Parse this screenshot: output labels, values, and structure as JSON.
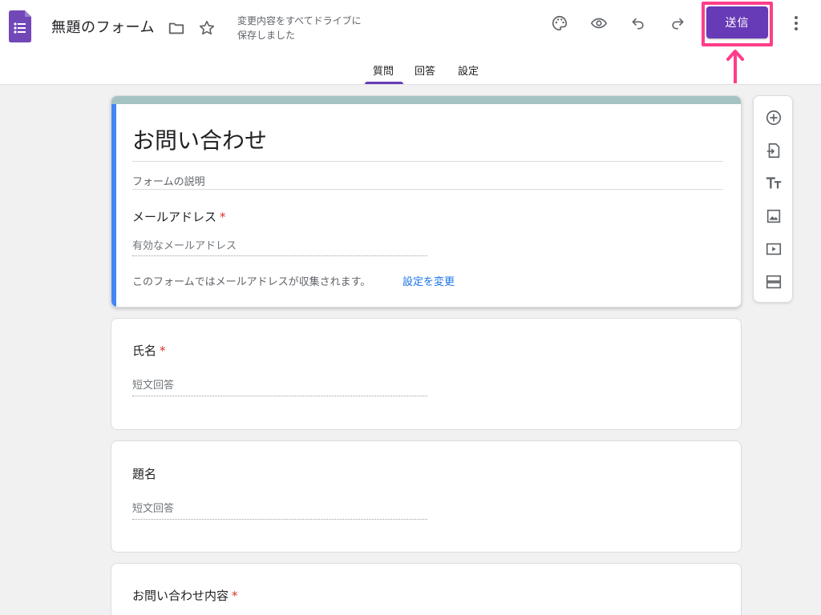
{
  "header": {
    "doc_title": "無題のフォーム",
    "save_status_line1": "変更内容をすべてドライブに",
    "save_status_line2": "保存しました",
    "send_label": "送信",
    "icons": [
      "forms-app-logo",
      "folder-icon",
      "star-icon",
      "palette-icon",
      "preview-eye-icon",
      "undo-icon",
      "redo-icon",
      "more-vert-icon"
    ]
  },
  "tabs": [
    {
      "label": "質問",
      "active": true
    },
    {
      "label": "回答",
      "active": false
    },
    {
      "label": "設定",
      "active": false
    }
  ],
  "form": {
    "title": "お問い合わせ",
    "description_placeholder": "フォームの説明",
    "email_question": {
      "label": "メールアドレス",
      "required_mark": "*",
      "placeholder": "有効なメールアドレス",
      "note": "このフォームではメールアドレスが収集されます。",
      "link": "設定を変更"
    },
    "questions": [
      {
        "label": "氏名",
        "required_mark": "*",
        "placeholder": "短文回答"
      },
      {
        "label": "題名",
        "required_mark": "",
        "placeholder": "短文回答"
      },
      {
        "label": "お問い合わせ内容",
        "required_mark": "*",
        "placeholder": ""
      }
    ]
  },
  "side_toolbar": [
    "add-question-icon",
    "import-questions-icon",
    "add-title-icon",
    "add-image-icon",
    "add-video-icon",
    "add-section-icon"
  ],
  "colors": {
    "accent": "#673ab7",
    "highlight": "#ff3d8a",
    "card_stripe": "#a5c3c3",
    "active_border": "#4285f4",
    "link": "#1a73e8",
    "required": "#d93025"
  }
}
